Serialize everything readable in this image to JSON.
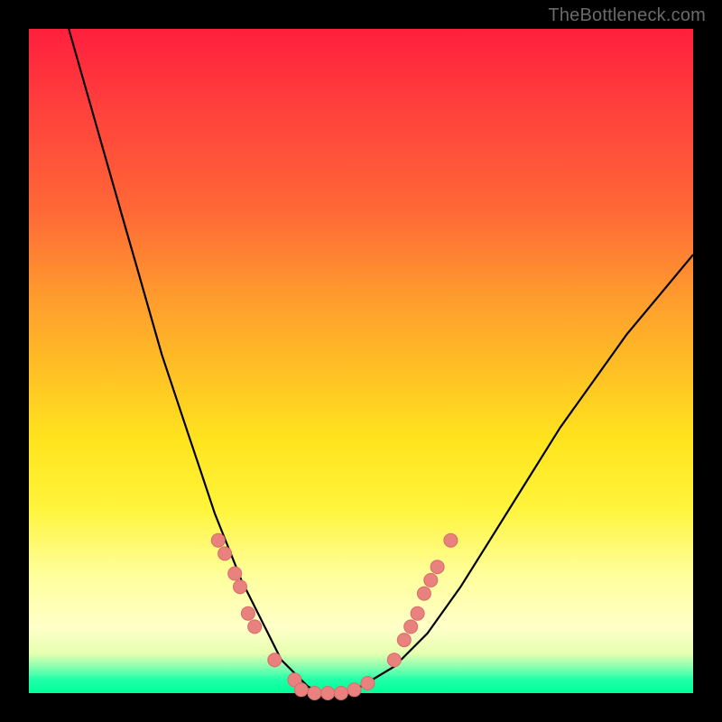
{
  "watermark": "TheBottleneck.com",
  "chart_data": {
    "type": "line",
    "title": "",
    "xlabel": "",
    "ylabel": "",
    "xlim": [
      0,
      100
    ],
    "ylim": [
      0,
      100
    ],
    "grid": false,
    "legend": false,
    "series": [
      {
        "name": "bottleneck-curve",
        "x": [
          6,
          8,
          10,
          12,
          14,
          16,
          18,
          20,
          22,
          24,
          26,
          28,
          30,
          32,
          34,
          36,
          38,
          40,
          42,
          44,
          46,
          48,
          50,
          55,
          60,
          65,
          70,
          75,
          80,
          85,
          90,
          95,
          100
        ],
        "y": [
          100,
          93,
          86,
          79,
          72,
          65,
          58,
          51,
          45,
          39,
          33,
          27,
          22,
          17,
          13,
          9,
          5,
          3,
          1,
          0,
          0,
          0,
          1,
          4,
          9,
          16,
          24,
          32,
          40,
          47,
          54,
          60,
          66
        ]
      }
    ],
    "markers": [
      {
        "x": 28.5,
        "y": 23
      },
      {
        "x": 29.5,
        "y": 21
      },
      {
        "x": 31.0,
        "y": 18
      },
      {
        "x": 31.8,
        "y": 16
      },
      {
        "x": 33.0,
        "y": 12
      },
      {
        "x": 34.0,
        "y": 10
      },
      {
        "x": 37.0,
        "y": 5
      },
      {
        "x": 40.0,
        "y": 2
      },
      {
        "x": 41.0,
        "y": 0.5
      },
      {
        "x": 43.0,
        "y": 0
      },
      {
        "x": 45.0,
        "y": 0
      },
      {
        "x": 47.0,
        "y": 0
      },
      {
        "x": 49.0,
        "y": 0.5
      },
      {
        "x": 51.0,
        "y": 1.5
      },
      {
        "x": 55.0,
        "y": 5
      },
      {
        "x": 56.5,
        "y": 8
      },
      {
        "x": 57.5,
        "y": 10
      },
      {
        "x": 58.5,
        "y": 12
      },
      {
        "x": 59.5,
        "y": 15
      },
      {
        "x": 60.5,
        "y": 17
      },
      {
        "x": 61.5,
        "y": 19
      },
      {
        "x": 63.5,
        "y": 23
      }
    ],
    "colors": {
      "curve": "#000000",
      "marker_fill": "#e9827f",
      "marker_stroke": "#d86b68"
    }
  }
}
